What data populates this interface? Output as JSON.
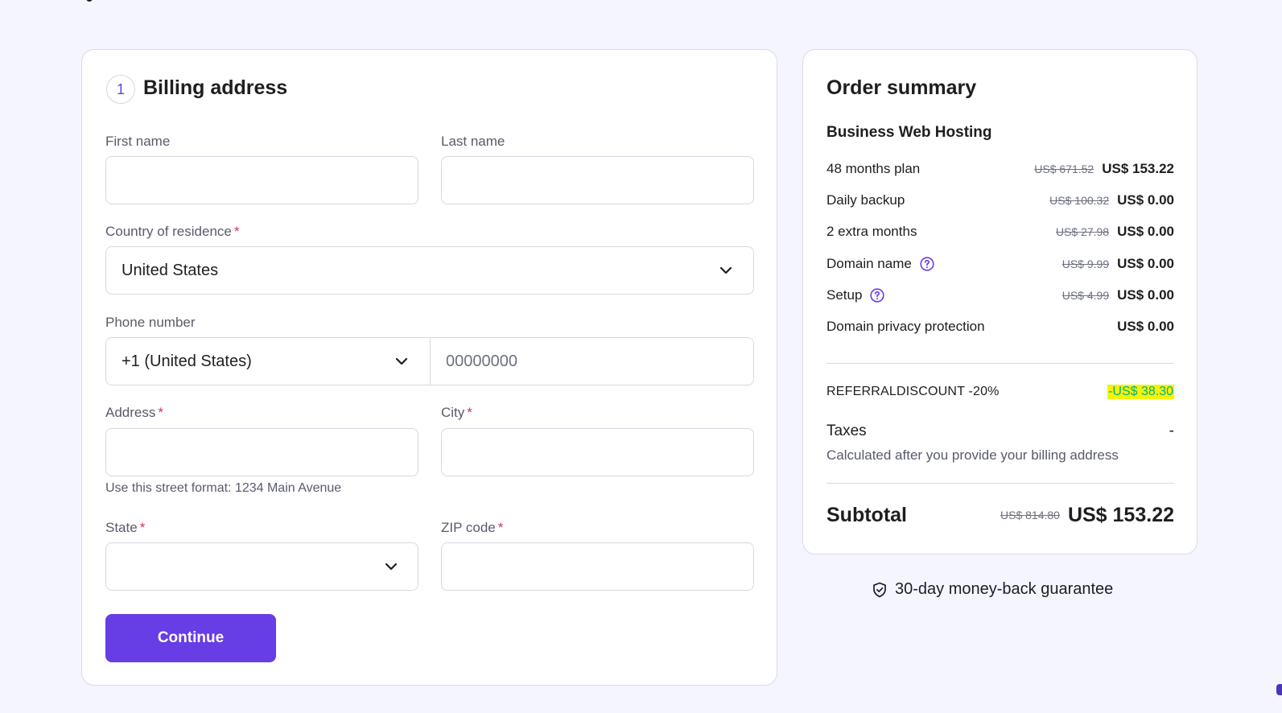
{
  "billing": {
    "step_number": "1",
    "title": "Billing address",
    "first_name_label": "First name",
    "last_name_label": "Last name",
    "country_label": "Country of residence",
    "required_mark": "*",
    "country_value": "United States",
    "phone_label": "Phone number",
    "phone_code_value": "+1 (United States)",
    "phone_placeholder": "00000000",
    "address_label": "Address",
    "address_hint": "Use this street format: 1234 Main Avenue",
    "city_label": "City",
    "state_label": "State",
    "state_value": "",
    "zip_label": "ZIP code",
    "continue_label": "Continue"
  },
  "summary": {
    "title": "Order summary",
    "plan_name": "Business Web Hosting",
    "items": [
      {
        "label": "48 months plan",
        "old_price": "US$ 671.52",
        "price": "US$ 153.22",
        "help": false
      },
      {
        "label": "Daily backup",
        "old_price": "US$ 100.32",
        "price": "US$ 0.00",
        "help": false
      },
      {
        "label": "2 extra months",
        "old_price": "US$ 27.98",
        "price": "US$ 0.00",
        "help": false
      },
      {
        "label": "Domain name",
        "old_price": "US$ 9.99",
        "price": "US$ 0.00",
        "help": true
      },
      {
        "label": "Setup",
        "old_price": "US$ 4.99",
        "price": "US$ 0.00",
        "help": true
      },
      {
        "label": "Domain privacy protection",
        "old_price": "",
        "price": "US$ 0.00",
        "help": false
      }
    ],
    "discount_label": "REFERRALDISCOUNT -20%",
    "discount_value": "-US$ 38.30",
    "taxes_label": "Taxes",
    "taxes_value": "-",
    "taxes_note": "Calculated after you provide your billing address",
    "subtotal_label": "Subtotal",
    "subtotal_old": "US$ 814.80",
    "subtotal_value": "US$ 153.22"
  },
  "guarantee_text": "30-day money-back guarantee",
  "colors": {
    "accent": "#673de6",
    "background": "#f4f5ff",
    "required": "#d63163",
    "discount_text": "#00b090",
    "discount_highlight": "#f4f400"
  },
  "icons": [
    "chevron-down-icon",
    "help-circle-icon",
    "shield-check-icon"
  ]
}
